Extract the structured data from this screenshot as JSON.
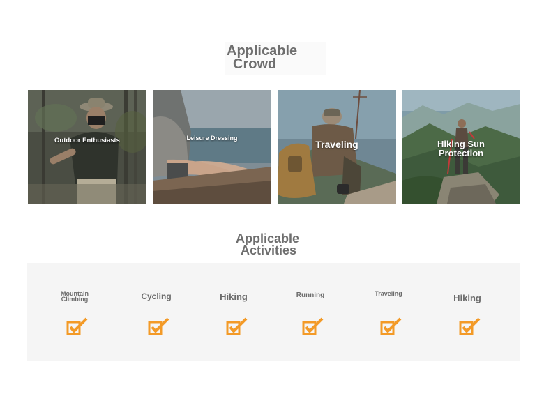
{
  "crowd": {
    "title_line1": "Applicable",
    "title_line2": "Crowd",
    "cards": [
      {
        "label": "Outdoor Enthusiasts"
      },
      {
        "label": "Leisure Dressing"
      },
      {
        "label": "Traveling"
      },
      {
        "label_line1": "Hiking Sun",
        "label_line2": "Protection"
      }
    ]
  },
  "activities": {
    "title_line1": "Applicable",
    "title_line2": "Activities",
    "items": [
      {
        "line1": "Mountain",
        "line2": "Climbing",
        "icon": "checkbox-checked-icon"
      },
      {
        "line1": "Cycling",
        "icon": "checkbox-checked-icon"
      },
      {
        "line1": "Hiking",
        "icon": "checkbox-checked-icon"
      },
      {
        "line1": "Running",
        "icon": "checkbox-checked-icon"
      },
      {
        "line1": "Traveling",
        "icon": "checkbox-checked-icon"
      },
      {
        "line1": "Hiking",
        "icon": "checkbox-checked-icon"
      }
    ]
  },
  "colors": {
    "heading": "#6e6e6e",
    "check_accent": "#f39a27",
    "panel_bg": "#f5f5f5"
  }
}
